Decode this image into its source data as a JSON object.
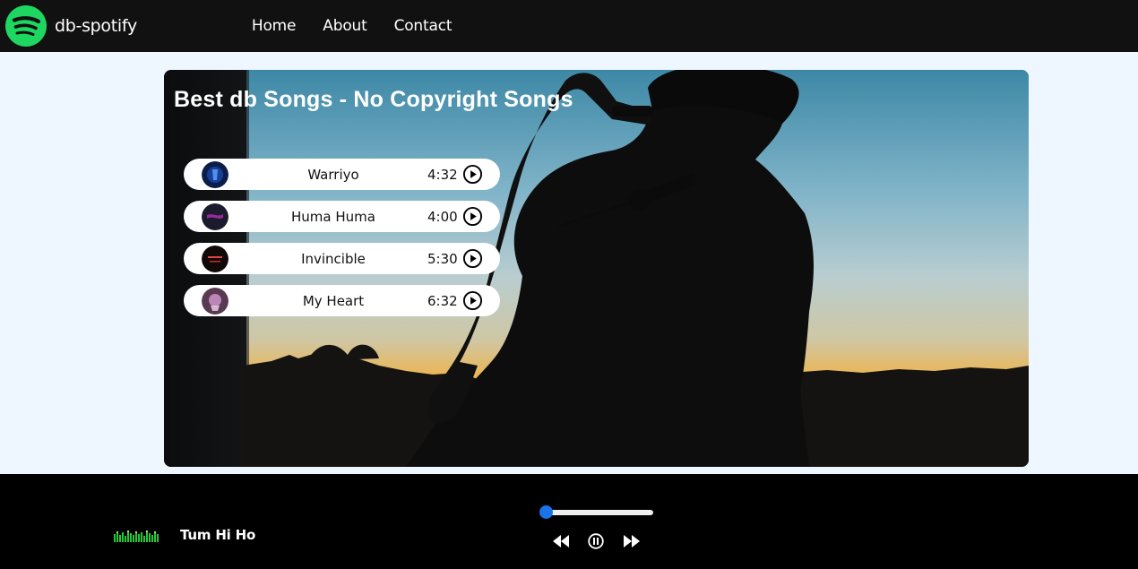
{
  "navbar": {
    "brand_name": "db-spotify",
    "brand_color": "#1ed760",
    "links": [
      {
        "label": "Home"
      },
      {
        "label": "About"
      },
      {
        "label": "Contact"
      }
    ]
  },
  "hero": {
    "title": "Best db Songs - No Copyright Songs",
    "songs": [
      {
        "name": "Warriyo",
        "duration": "4:32",
        "icon": "play-circle-icon"
      },
      {
        "name": "Huma Huma",
        "duration": "4:00",
        "icon": "play-circle-icon"
      },
      {
        "name": "Invincible",
        "duration": "5:30",
        "icon": "play-circle-icon"
      },
      {
        "name": "My Heart",
        "duration": "6:32",
        "icon": "play-circle-icon"
      }
    ]
  },
  "player": {
    "now_playing": "Tum Hi Ho",
    "progress": 0,
    "accent": "#1a73e8",
    "controls": {
      "previous": "backward-icon",
      "toggle": "pause-icon",
      "next": "forward-icon"
    }
  }
}
